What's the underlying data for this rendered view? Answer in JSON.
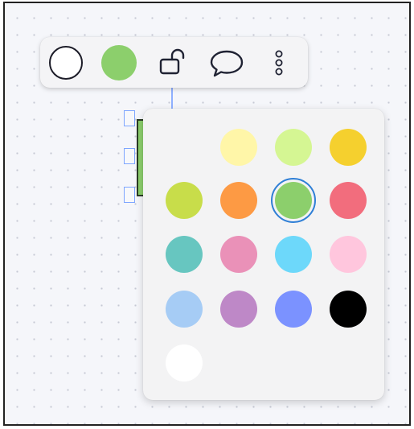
{
  "toolbar": {
    "stroke_color": "#ffffff",
    "fill_color": "#8ccf6c",
    "icons": [
      "stroke-color",
      "fill-color",
      "unlock-icon",
      "comment-icon",
      "more-vertical-icon"
    ]
  },
  "palette": {
    "selected": "#8ccf6c",
    "swatches": [
      {
        "name": "swatch-light-yellow",
        "color": "#fff6a8"
      },
      {
        "name": "swatch-light-green",
        "color": "#d5f693"
      },
      {
        "name": "swatch-yellow",
        "color": "#f5d02e"
      },
      {
        "name": "swatch-lime",
        "color": "#c8dd4a"
      },
      {
        "name": "swatch-orange",
        "color": "#fd9a44"
      },
      {
        "name": "swatch-green",
        "color": "#8ccf6c"
      },
      {
        "name": "swatch-red",
        "color": "#f26d7d"
      },
      {
        "name": "swatch-teal",
        "color": "#67c6c0"
      },
      {
        "name": "swatch-pink",
        "color": "#ea91b8"
      },
      {
        "name": "swatch-light-blue",
        "color": "#6dd8fa"
      },
      {
        "name": "swatch-light-pink",
        "color": "#ffc6dd"
      },
      {
        "name": "swatch-pale-blue",
        "color": "#a6ccf5"
      },
      {
        "name": "swatch-violet",
        "color": "#be88c7"
      },
      {
        "name": "swatch-blue",
        "color": "#7b92ff"
      },
      {
        "name": "swatch-black",
        "color": "#000000"
      },
      {
        "name": "swatch-white",
        "color": "#ffffff"
      }
    ]
  }
}
